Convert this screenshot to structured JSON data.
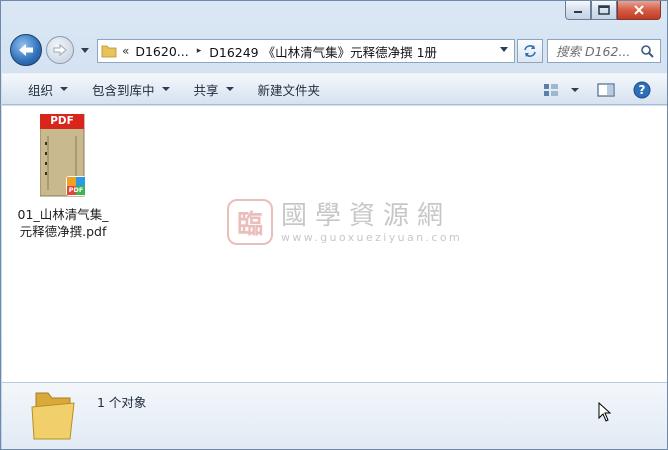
{
  "address": {
    "overflow_glyph": "«",
    "crumbs": [
      "D1620...",
      "D16249 《山林清气集》元释德净撰 1册"
    ],
    "separator": "▸"
  },
  "search": {
    "placeholder": "搜索 D162..."
  },
  "toolbar": {
    "organize": "组织",
    "include_in_library": "包含到库中",
    "share": "共享",
    "new_folder": "新建文件夹"
  },
  "file": {
    "name_line1": "01_山林清气集_",
    "name_line2": "元释德净撰.pdf",
    "badge_label": "PDF",
    "type_label": "PDF"
  },
  "watermark": {
    "seal": "臨",
    "title": "國學資源網",
    "url": "www.guoxueziyuan.com"
  },
  "details": {
    "count_text": "1 个对象"
  },
  "icons": {
    "back": "back-arrow-icon",
    "forward": "forward-arrow-icon",
    "refresh": "refresh-icon",
    "search": "search-icon",
    "view": "view-options-icon",
    "preview": "preview-pane-icon",
    "help": "help-icon"
  },
  "colors": {
    "accent": "#2f6fb8",
    "pdf_red": "#d9261c",
    "close_red": "#c23a22"
  }
}
